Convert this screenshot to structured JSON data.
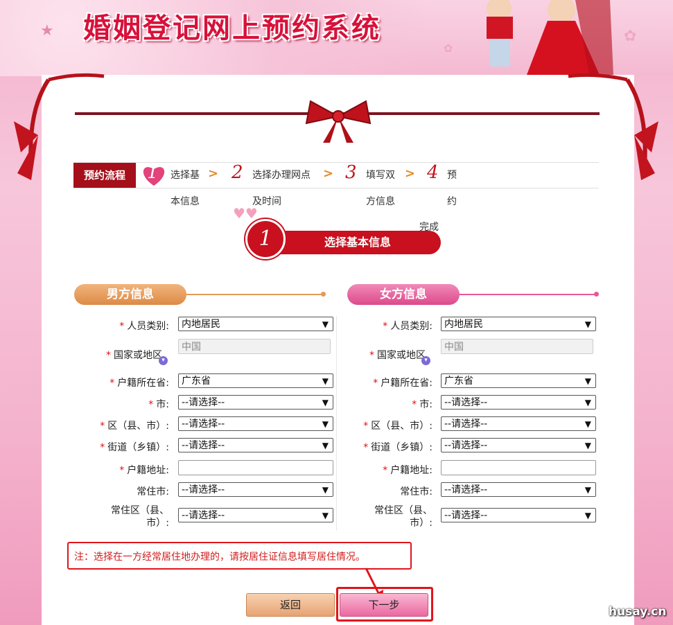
{
  "banner": {
    "title": "婚姻登记网上预约系统"
  },
  "steps": {
    "tag": "预约流程",
    "items": [
      {
        "num": "1",
        "line1": "选择基",
        "line2": "本信息"
      },
      {
        "num": "2",
        "line1": "选择办理网点",
        "line2": "及时间"
      },
      {
        "num": "3",
        "line1": "填写双",
        "line2": "方信息"
      },
      {
        "num": "4",
        "line1": "预",
        "line2": "约",
        "line3": "完成"
      }
    ]
  },
  "current_step": {
    "num": "1",
    "title": "选择基本信息"
  },
  "male": {
    "header": "男方信息",
    "person_type_label": "人员类别:",
    "person_type_value": "内地居民",
    "country_label": "国家或地区",
    "country_value": "中国",
    "province_label": "户籍所在省:",
    "province_value": "广东省",
    "city_label": "市:",
    "city_value": "--请选择--",
    "district_label": "区（县、市）:",
    "district_value": "--请选择--",
    "street_label": "街道（乡镇）:",
    "street_value": "--请选择--",
    "address_label": "户籍地址:",
    "address_value": "",
    "res_city_label": "常住市:",
    "res_city_value": "--请选择--",
    "res_district_label": "常住区（县、市）:",
    "res_district_value": "--请选择--"
  },
  "female": {
    "header": "女方信息",
    "person_type_label": "人员类别:",
    "person_type_value": "内地居民",
    "country_label": "国家或地区",
    "country_value": "中国",
    "province_label": "户籍所在省:",
    "province_value": "广东省",
    "city_label": "市:",
    "city_value": "--请选择--",
    "district_label": "区（县、市）:",
    "district_value": "--请选择--",
    "street_label": "街道（乡镇）:",
    "street_value": "--请选择--",
    "address_label": "户籍地址:",
    "address_value": "",
    "res_city_label": "常住市:",
    "res_city_value": "--请选择--",
    "res_district_label": "常住区（县、市）:",
    "res_district_value": "--请选择--"
  },
  "required_mark": "*",
  "note": "注：选择在一方经常居住地办理的，请按居住证信息填写居住情况。",
  "buttons": {
    "back": "返回",
    "next": "下一步"
  },
  "watermark": "husay.cn",
  "colors": {
    "accent_red": "#c8101e",
    "male_orange": "#e29a57",
    "female_pink": "#e45a97"
  }
}
